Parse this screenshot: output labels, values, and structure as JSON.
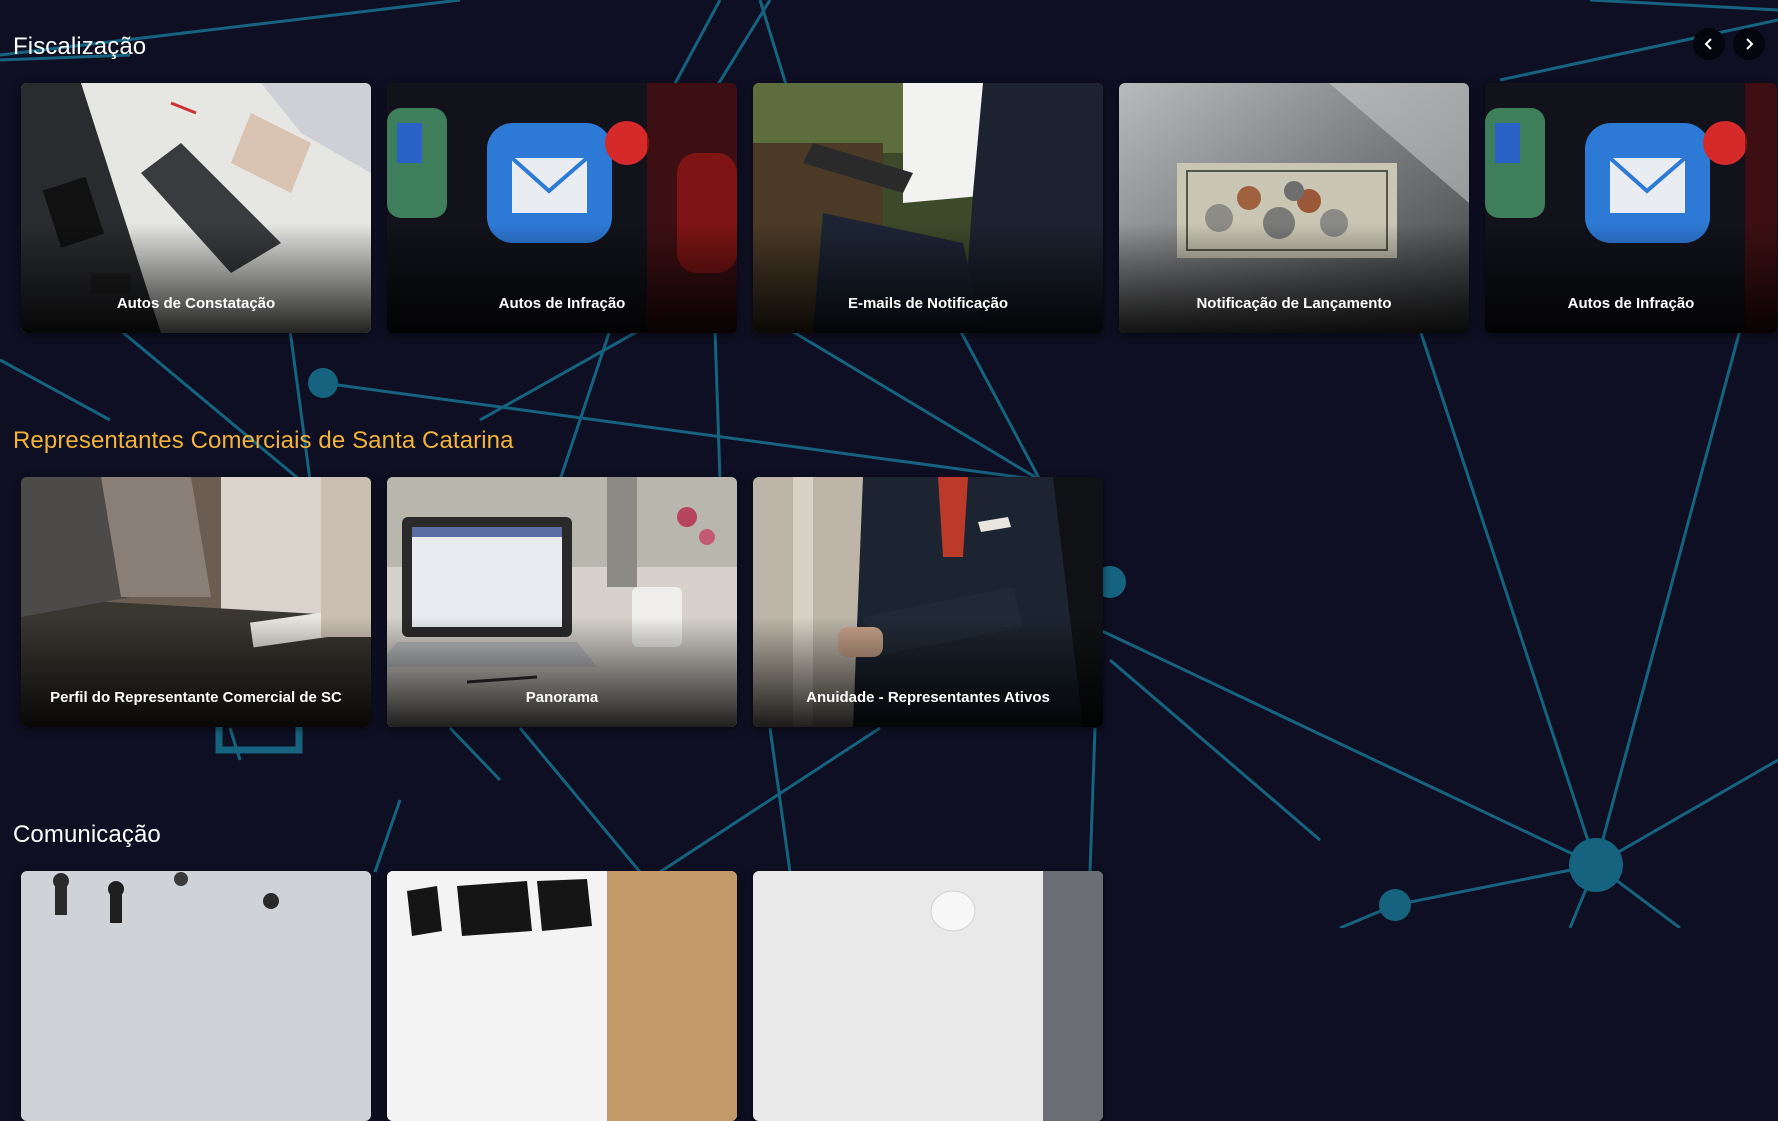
{
  "sections": [
    {
      "title": "Fiscalização",
      "cards": [
        {
          "label": "Autos de Constatação",
          "image": "office-laptop-desk-photo"
        },
        {
          "label": "Autos de Infração",
          "image": "mail-app-icons-photo"
        },
        {
          "label": "E-mails de Notificação",
          "image": "businessmen-tablet-photo"
        },
        {
          "label": "Notificação de Lançamento",
          "image": "dollar-bill-coins-photo"
        },
        {
          "label": "Autos de Infração",
          "image": "mail-app-icons-photo"
        }
      ]
    },
    {
      "title": "Representantes Comerciais de Santa Catarina",
      "cards": [
        {
          "label": "Perfil do Representante Comercial de SC",
          "image": "meeting-table-photo"
        },
        {
          "label": "Panorama",
          "image": "laptop-coffee-desk-photo"
        },
        {
          "label": "Anuidade - Representantes Ativos",
          "image": "suited-man-arms-crossed-photo"
        }
      ]
    },
    {
      "title": "Comunicação",
      "cards": [
        {
          "label": "",
          "image": "crowd-walking-photo"
        },
        {
          "label": "",
          "image": "how-sign-photo"
        },
        {
          "label": "",
          "image": "white-interior-photo"
        }
      ]
    }
  ],
  "carousel": {
    "prev_icon": "chevron-left-icon",
    "next_icon": "chevron-right-icon"
  },
  "colors": {
    "background": "#0e0f22",
    "network_line": "#16637f",
    "highlight_title": "#f2b33a"
  }
}
